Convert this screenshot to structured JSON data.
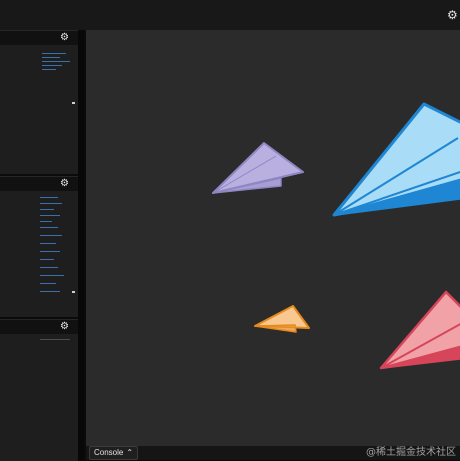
{
  "topbar": {
    "settings_icon": "gear-icon"
  },
  "panels": [
    {
      "id": "panel-1",
      "settings_icon": "gear-icon"
    },
    {
      "id": "panel-2",
      "settings_icon": "gear-icon"
    },
    {
      "id": "panel-3",
      "settings_icon": "gear-icon"
    }
  ],
  "stage": {
    "background": "#2b2b2b",
    "planes": [
      {
        "name": "purple-plane",
        "color": "#c9c1ea",
        "stroke": "#8f86c4"
      },
      {
        "name": "blue-plane",
        "color": "#a9dcf7",
        "stroke": "#1e86d2"
      },
      {
        "name": "orange-plane",
        "color": "#f8c890",
        "stroke": "#e58a1f"
      },
      {
        "name": "red-plane",
        "color": "#f0a2a7",
        "stroke": "#d6455a"
      }
    ]
  },
  "console": {
    "label": "Console",
    "toggle_icon": "chevron-up-icon"
  },
  "watermark": "@稀土掘金技术社区"
}
